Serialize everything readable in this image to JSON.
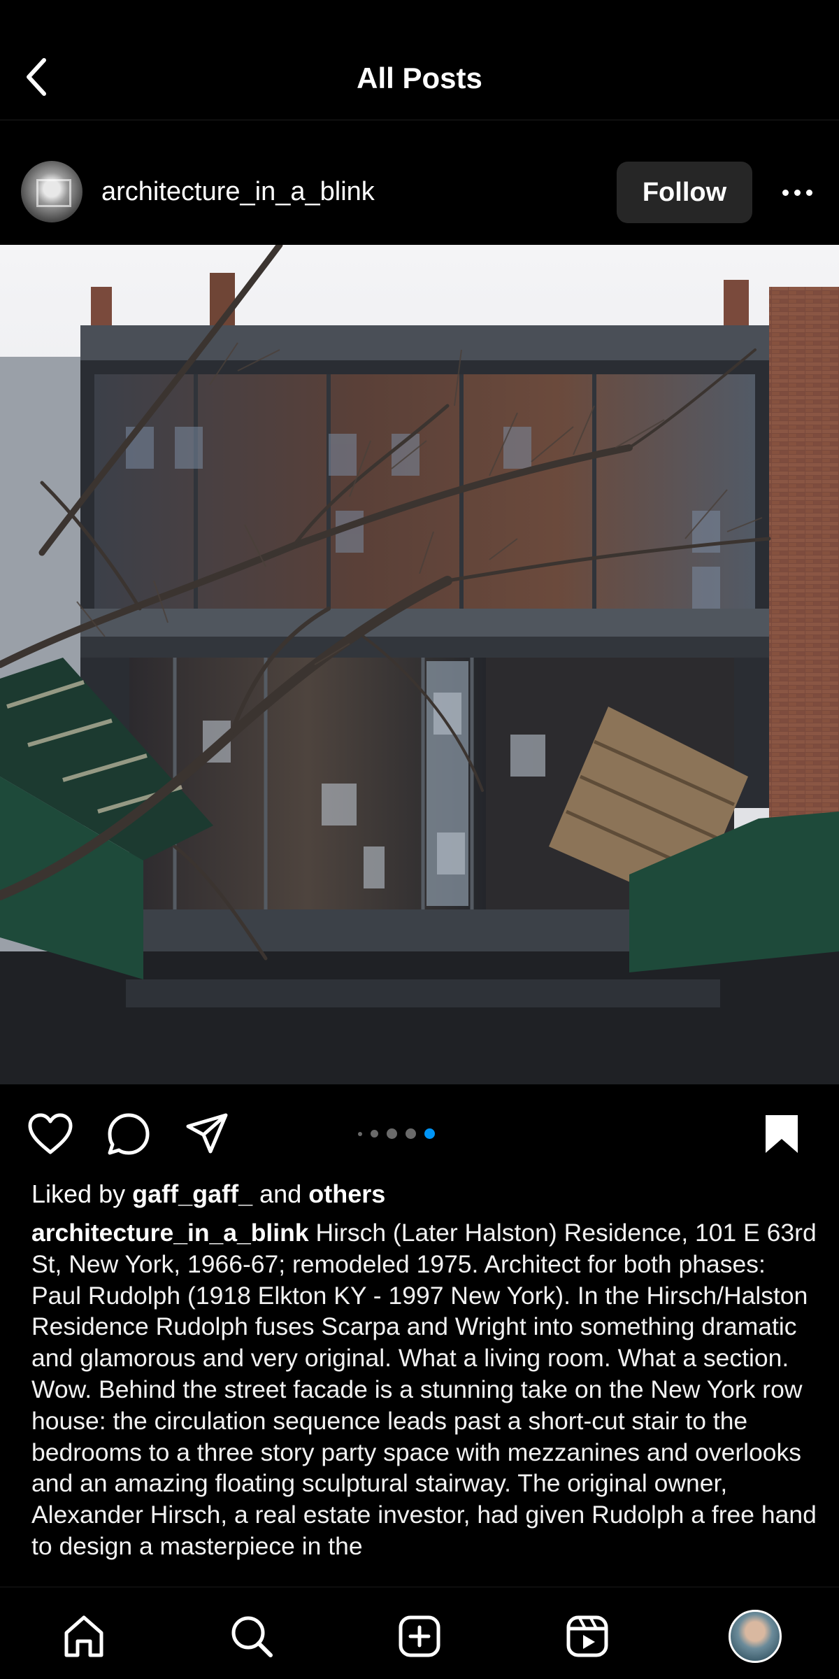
{
  "header": {
    "title": "All Posts"
  },
  "post": {
    "username": "architecture_in_a_blink",
    "follow_label": "Follow",
    "image_alt": "Glass and steel residence facade with bare tree branches",
    "carousel": {
      "count": 5,
      "active_index": 4
    },
    "likes": {
      "prefix": "Liked by",
      "user": "gaff_gaff_",
      "conjunction": "and",
      "others": "others"
    },
    "caption": {
      "username": "architecture_in_a_blink",
      "text": "Hirsch (Later Halston) Residence, 101 E 63rd St, New York, 1966-67; remodeled 1975. Architect for both phases: Paul Rudolph (1918 Elkton KY - 1997 New York). In the Hirsch/Halston Residence Rudolph fuses Scarpa and Wright into something dramatic and glamorous and very original. What a living room. What a section. Wow. Behind the street facade is a stunning take on the New York row house: the circulation sequence leads past a short-cut stair to the bedrooms to a three story party space with mezzanines and overlooks and an amazing floating sculptural stairway. The original owner, Alexander Hirsch, a real estate investor, had given Rudolph a free hand to design a masterpiece in the"
    }
  },
  "nav": {
    "items": [
      "home-icon",
      "search-icon",
      "create-icon",
      "reels-icon",
      "profile-avatar"
    ]
  },
  "colors": {
    "background": "#000000",
    "follow_bg": "#262626",
    "active_dot": "#0095f6",
    "inactive_dot": "#6a6a6a"
  }
}
